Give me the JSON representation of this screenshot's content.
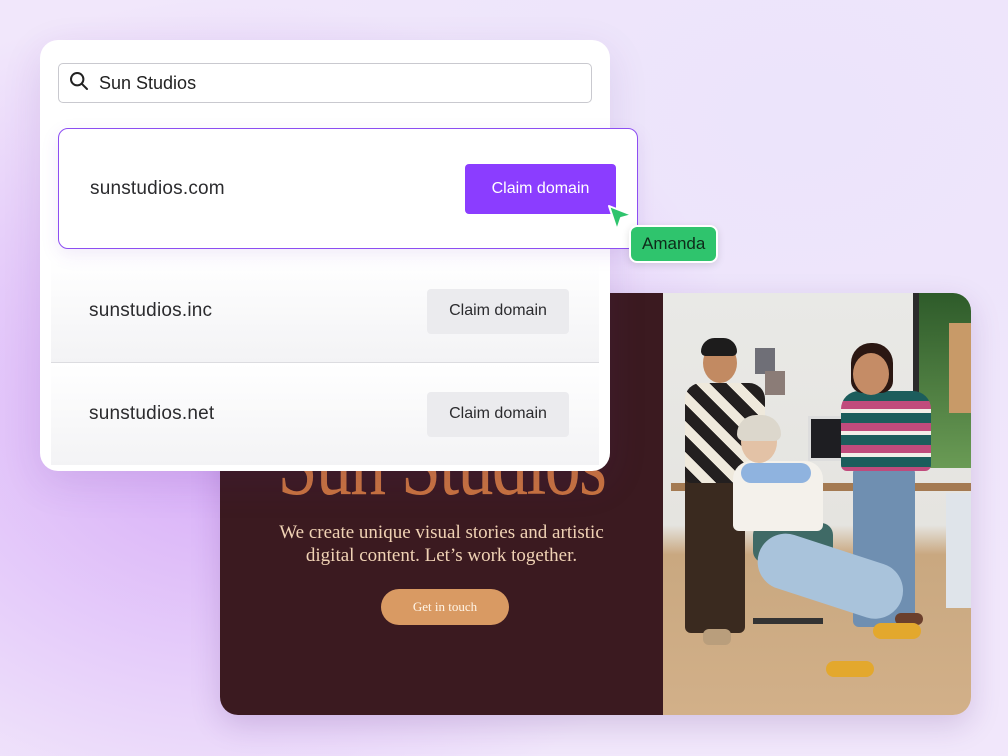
{
  "search": {
    "value": "Sun Studios",
    "icon": "search-icon"
  },
  "results": [
    {
      "domain": "sunstudios.com",
      "action": "Claim domain",
      "selected": true
    },
    {
      "domain": "sunstudios.inc",
      "action": "Claim domain",
      "selected": false
    },
    {
      "domain": "sunstudios.net",
      "action": "Claim domain",
      "selected": false
    }
  ],
  "collaborator": {
    "name": "Amanda",
    "color": "#2fc46d"
  },
  "website": {
    "title": "Sun Studios",
    "subtitle": "We create unique visual stories and artistic digital content. Let’s work together.",
    "cta": "Get in touch"
  },
  "colors": {
    "accent": "#8b3dff",
    "site_background": "#3b1a20",
    "site_title": "#c8733e",
    "cta": "#d99a63"
  }
}
